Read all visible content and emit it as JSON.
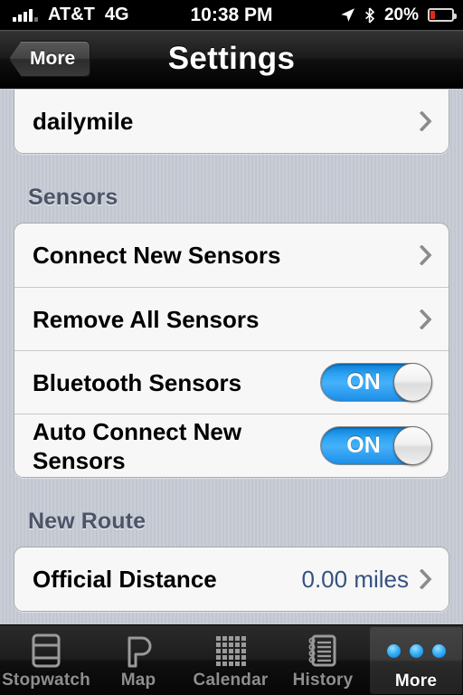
{
  "status_bar": {
    "carrier": "AT&T",
    "network": "4G",
    "time": "10:38 PM",
    "battery_percent": "20%",
    "battery_level": 20,
    "icons": [
      "signal-bars-icon",
      "location-arrow-icon",
      "bluetooth-icon",
      "battery-icon"
    ]
  },
  "nav_bar": {
    "back_label": "More",
    "title": "Settings"
  },
  "sections": [
    {
      "header": "",
      "clipped": true,
      "rows": [
        {
          "label": "dailymile",
          "type": "disclosure",
          "value": ""
        }
      ]
    },
    {
      "header": "Sensors",
      "clipped": false,
      "rows": [
        {
          "label": "Connect New Sensors",
          "type": "disclosure",
          "value": ""
        },
        {
          "label": "Remove All Sensors",
          "type": "disclosure",
          "value": ""
        },
        {
          "label": "Bluetooth Sensors",
          "type": "toggle",
          "toggle_label": "ON",
          "toggle_on": true
        },
        {
          "label": "Auto Connect New Sensors",
          "type": "toggle",
          "toggle_label": "ON",
          "toggle_on": true
        }
      ]
    },
    {
      "header": "New Route",
      "clipped": false,
      "rows": [
        {
          "label": "Official Distance",
          "type": "value-disclosure",
          "value": "0.00 miles"
        }
      ]
    }
  ],
  "tab_bar": {
    "selected": "More",
    "tabs": [
      {
        "label": "Stopwatch",
        "icon": "stopwatch-icon"
      },
      {
        "label": "Map",
        "icon": "map-icon"
      },
      {
        "label": "Calendar",
        "icon": "calendar-icon"
      },
      {
        "label": "History",
        "icon": "history-icon"
      },
      {
        "label": "More",
        "icon": "more-dots-icon"
      }
    ]
  },
  "colors": {
    "accent_blue": "#2ea3f2",
    "value_text": "#36527f",
    "section_header": "#4c5468",
    "background": "#c6cbd4",
    "row_background": "#f7f7f7",
    "battery_red": "#e02b1c"
  }
}
